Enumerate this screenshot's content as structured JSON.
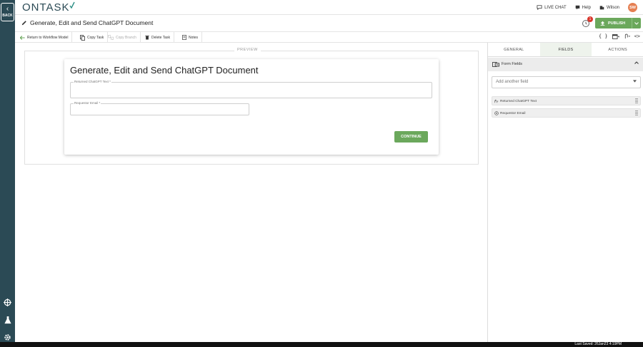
{
  "rail": {
    "back_label": "BACK"
  },
  "header": {
    "logo_text": "ONTASK",
    "live_chat": "LIVE CHAT",
    "help": "Help",
    "user_name": "Wilson",
    "avatar_initials": "SW"
  },
  "titlebar": {
    "title": "Generate, Edit and Send ChatGPT Document",
    "notification_count": "1",
    "publish_label": "PUBLISH"
  },
  "toolbar": {
    "return_label": "Return to Workflow Model",
    "copy_task_label": "Copy Task",
    "copy_branch_label": "Copy Branch",
    "delete_task_label": "Delete Task",
    "notes_label": "Notes"
  },
  "preview": {
    "label": "PREVIEW",
    "form_title": "Generate, Edit and Send ChatGPT Document",
    "fields": [
      {
        "label": "Returned ChatGPT Text *"
      },
      {
        "label": "Requestor Email *"
      }
    ],
    "continue_label": "CONTINUE"
  },
  "right_panel": {
    "tabs": [
      {
        "label": "GENERAL",
        "active": false
      },
      {
        "label": "FIELDS",
        "active": true
      },
      {
        "label": "ACTIONS",
        "active": false
      }
    ],
    "section_title": "Form Fields",
    "add_placeholder": "Add another field",
    "form_fields": [
      {
        "label": "Returned ChatGPT Text",
        "icon": "text-field-icon"
      },
      {
        "label": "Requestor Email",
        "icon": "at-sign-icon"
      }
    ]
  },
  "footer": {
    "last_saved": "Last Saved: 26Jan23 4:19PM"
  },
  "colors": {
    "rail": "#2b4a55",
    "accent_green": "#6ba85c",
    "badge_red": "#d9362b",
    "avatar": "#e57f52"
  }
}
